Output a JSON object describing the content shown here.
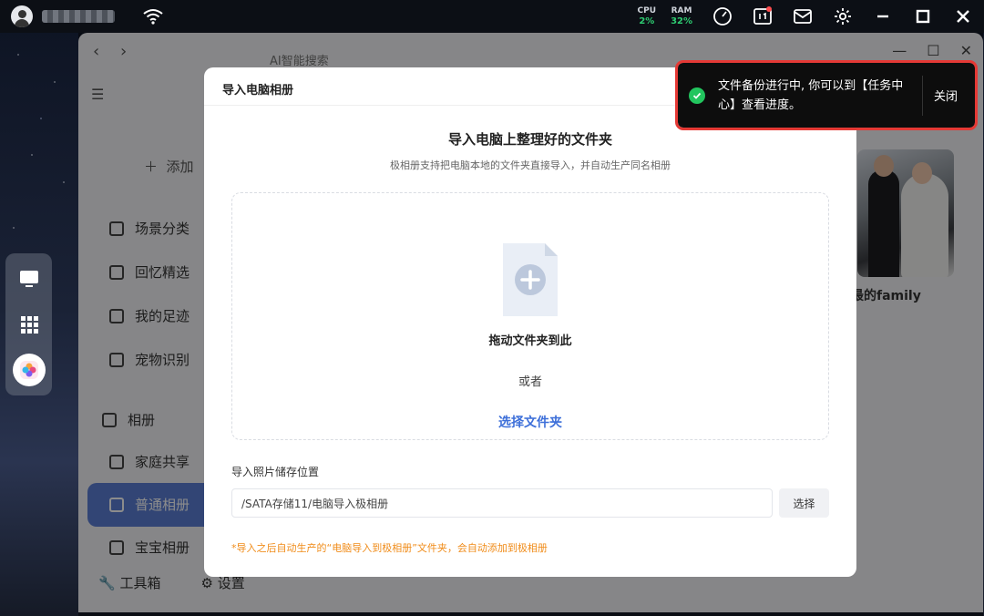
{
  "topbar": {
    "cpu_label": "CPU",
    "cpu_value": "2%",
    "ram_label": "RAM",
    "ram_value": "32%"
  },
  "app": {
    "search_label": "AI智能搜索",
    "add_label": "添加",
    "nav_items": [
      {
        "label": "场景分类"
      },
      {
        "label": "回忆精选"
      },
      {
        "label": "我的足迹"
      },
      {
        "label": "宠物识别"
      }
    ],
    "albums_section": "相册",
    "album_items": [
      {
        "label": "家庭共享"
      },
      {
        "label": "普通相册"
      },
      {
        "label": "宝宝相册"
      }
    ],
    "toolbox_label": "工具箱",
    "settings_label": "设置",
    "album_card_label": "最的family"
  },
  "dialog": {
    "header": "导入电脑相册",
    "title": "导入电脑上整理好的文件夹",
    "subtitle": "极相册支持把电脑本地的文件夹直接导入，并自动生产同名相册",
    "drag_text": "拖动文件夹到此",
    "or_text": "或者",
    "choose_folder": "选择文件夹",
    "location_label": "导入照片储存位置",
    "location_value": "/SATA存储11/电脑导入极相册",
    "select_button": "选择",
    "note": "*导入之后自动生产的“电脑导入到极相册”文件夹，会自动添加到极相册"
  },
  "toast": {
    "message": "文件备份进行中, 你可以到【任务中心】查看进度。",
    "close_label": "关闭"
  }
}
